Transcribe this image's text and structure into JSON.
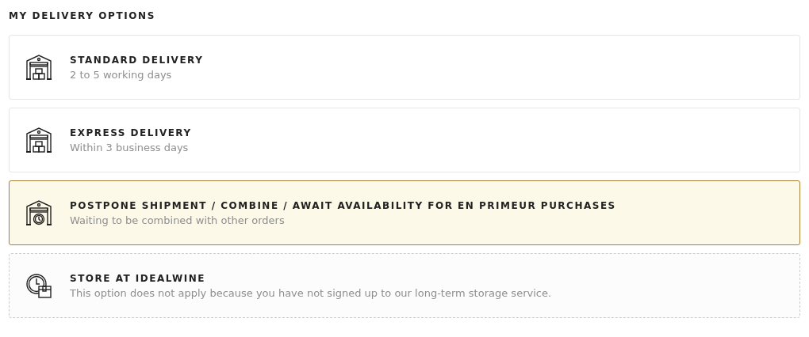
{
  "heading": "MY DELIVERY OPTIONS",
  "options": [
    {
      "kind": "warehouse-boxes",
      "title": "STANDARD DELIVERY",
      "subtitle": "2 to 5 working days",
      "selected": false,
      "disabled": false
    },
    {
      "kind": "warehouse-boxes",
      "title": "EXPRESS DELIVERY",
      "subtitle": "Within 3 business days",
      "selected": false,
      "disabled": false
    },
    {
      "kind": "warehouse-clock",
      "title": "POSTPONE SHIPMENT / COMBINE / AWAIT AVAILABILITY FOR EN PRIMEUR PURCHASES",
      "subtitle": "Waiting to be combined with other orders",
      "selected": true,
      "disabled": false
    },
    {
      "kind": "clock-box",
      "title": "STORE AT IDEALWINE",
      "subtitle": "This option does not apply because you have not signed up to our long-term storage service.",
      "selected": false,
      "disabled": true
    }
  ]
}
